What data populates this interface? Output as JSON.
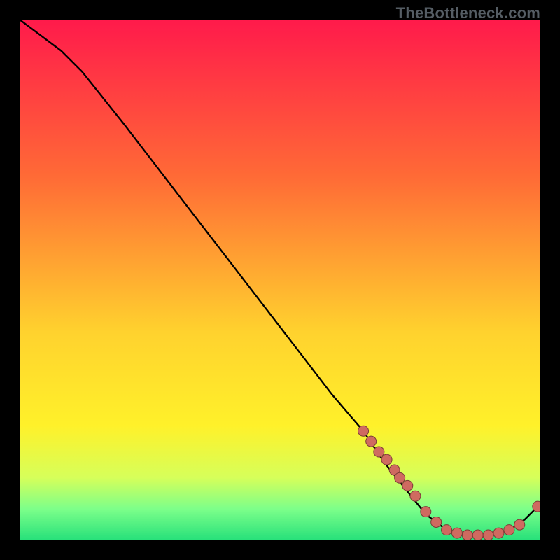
{
  "watermark": "TheBottleneck.com",
  "colors": {
    "top": "#ff1a4b",
    "mid1": "#ff6a36",
    "mid2": "#ffd22e",
    "mid3": "#fff12a",
    "low1": "#d6ff5a",
    "low2": "#7cff8a",
    "bottom": "#26e07a",
    "plot_bg": "#000000",
    "curve": "#000000",
    "marker_fill": "#cf6a60",
    "marker_stroke": "#7a3c36",
    "watermark": "#555d64"
  },
  "chart_data": {
    "type": "line",
    "title": "",
    "xlabel": "",
    "ylabel": "",
    "xlim": [
      0,
      100
    ],
    "ylim": [
      0,
      100
    ],
    "series": [
      {
        "name": "bottleneck-curve",
        "x": [
          0,
          4,
          8,
          12,
          20,
          30,
          40,
          50,
          60,
          66,
          70,
          74,
          78,
          82,
          86,
          90,
          94,
          97,
          100
        ],
        "y": [
          100,
          97,
          94,
          90,
          80,
          67,
          54,
          41,
          28,
          21,
          15,
          10,
          5,
          2,
          1,
          1,
          2,
          4,
          7
        ]
      }
    ],
    "marker_points": {
      "name": "highlighted-range",
      "x": [
        66,
        67.5,
        69,
        70.5,
        72,
        73,
        74.5,
        76,
        78,
        80,
        82,
        84,
        86,
        88,
        90,
        92,
        94,
        96,
        99.5
      ],
      "y": [
        21,
        19,
        17,
        15.5,
        13.5,
        12,
        10.5,
        8.5,
        5.5,
        3.5,
        2,
        1.4,
        1,
        1,
        1,
        1.4,
        2,
        3,
        6.5
      ]
    }
  }
}
